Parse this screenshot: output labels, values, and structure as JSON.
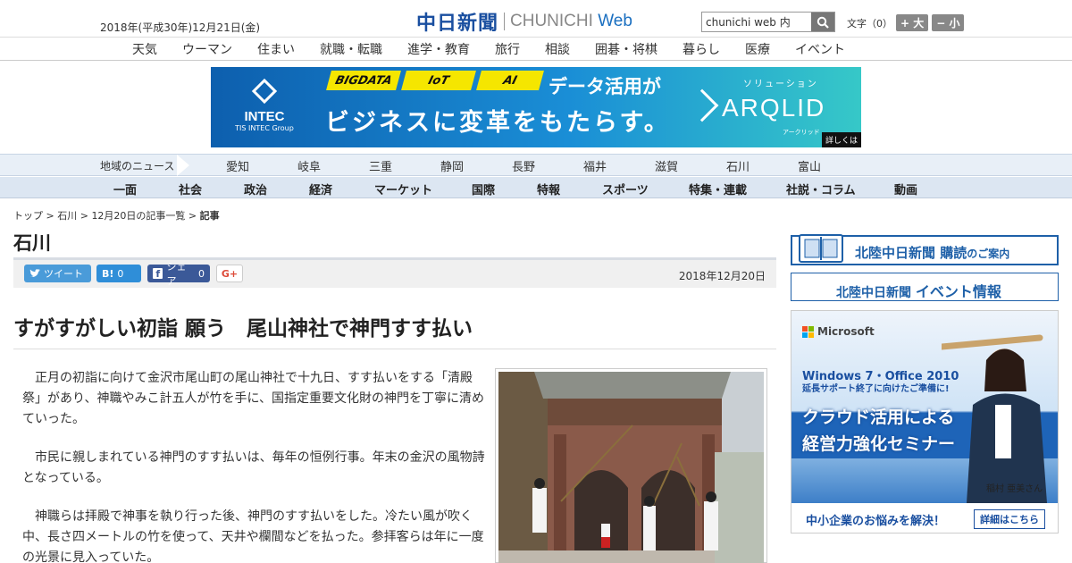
{
  "header": {
    "date": "2018年(平成30年)12月21日(金)",
    "logo_jp": "中日新聞",
    "logo_en": "CHUNICHI",
    "logo_web": "Web",
    "search_value": "chunichi web 内",
    "font_label": "文字（0）",
    "font_up": "+ 大",
    "font_down": "− 小"
  },
  "nav_main": [
    "天気",
    "ウーマン",
    "住まい",
    "就職・転職",
    "進学・教育",
    "旅行",
    "相談",
    "囲碁・将棋",
    "暮らし",
    "医療",
    "イベント"
  ],
  "banner": {
    "company": "INTEC",
    "company_sub": "TIS INTEC Group",
    "tags": [
      "BIGDATA",
      "IoT",
      "AI"
    ],
    "line1": "データ活用が",
    "line2": "ビジネスに変革をもたらす。",
    "solution": "ソリューション",
    "product": "ARQLID",
    "product_kana": "アークリッド",
    "more": "詳しくは"
  },
  "region": {
    "label": "地域のニュース",
    "items": [
      "愛知",
      "岐阜",
      "三重",
      "静岡",
      "長野",
      "福井",
      "滋賀",
      "石川",
      "富山"
    ]
  },
  "categories": [
    "一面",
    "社会",
    "政治",
    "経済",
    "マーケット",
    "国際",
    "特報",
    "スポーツ",
    "特集・連載",
    "社説・コラム",
    "動画"
  ],
  "breadcrumb": {
    "top": "トップ",
    "sep": " > ",
    "section": "石川",
    "list": "12月20日の記事一覧",
    "current": "記事"
  },
  "section_title": "石川",
  "share": {
    "tweet": "ツイート",
    "hatena_label": "B!",
    "hatena_count": "0",
    "fb_label": "シェア",
    "fb_count": "0",
    "gplus": "G+",
    "date": "2018年12月20日"
  },
  "article": {
    "headline": "すがすがしい初詣 願う　尾山神社で神門すす払い",
    "paragraphs": [
      "正月の初詣に向けて金沢市尾山町の尾山神社で十九日、すす払いをする「清殿祭」があり、神職やみこ計五人が竹を手に、国指定重要文化財の神門を丁寧に清めていった。",
      "市民に親しまれている神門のすす払いは、毎年の恒例行事。年末の金沢の風物詩となっている。",
      "神職らは拝殿で神事を執り行った後、神門のすす払いをした。冷たい風が吹く中、長さ四メートルの竹を使って、天井や欄間などを払った。参拝客らは年に一度の光景に見入っていた。"
    ]
  },
  "sidebar": {
    "subscribe_name": "北陸中日新聞",
    "subscribe_text": "購読",
    "subscribe_suffix": "のご案内",
    "event_name": "北陸中日新聞",
    "event_text": "イベント情報"
  },
  "ad": {
    "brand": "Microsoft",
    "l1": "Windows 7・Office 2010",
    "l2": "延長サポート終了に向けたご準備に!",
    "l3": "クラウド活用による",
    "l4": "経営力強化セミナー",
    "person": "稲村 亜美さん",
    "bottom": "中小企業のお悩みを解決！",
    "more": "詳細はこちら"
  }
}
